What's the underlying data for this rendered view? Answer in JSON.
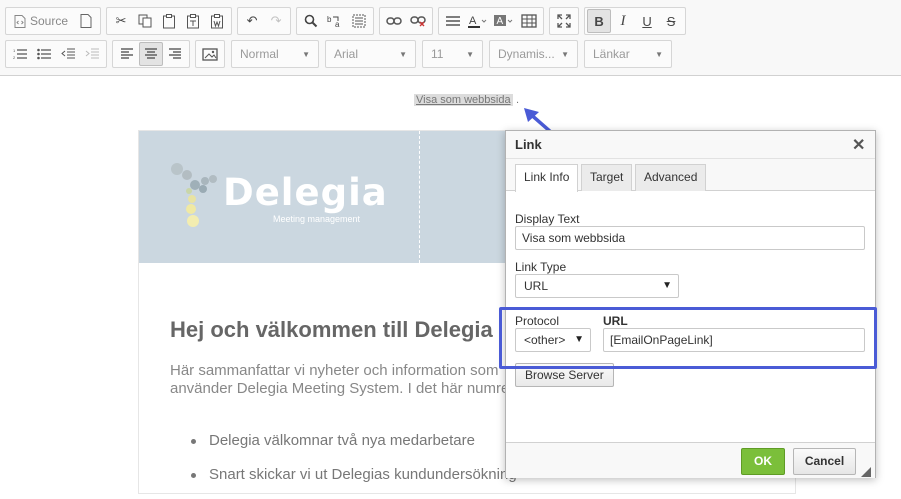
{
  "toolbar": {
    "source_label": "Source",
    "format_combo": "Normal",
    "font_combo": "Arial",
    "size_combo": "11",
    "dynamic_combo": "Dynamis...",
    "links_combo": "Länkar"
  },
  "editor": {
    "web_link_text": "Visa som webbsida",
    "web_link_dot": "."
  },
  "email": {
    "logo_text": "Delegia",
    "logo_subtitle": "Meeting management",
    "heading": "Hej och välkommen till Delegia",
    "paragraph_lines": [
      "Här sammanfattar vi nyheter och information som",
      "använder Delegia Meeting System. I det här numret"
    ],
    "list_items": [
      "Delegia välkomnar två nya medarbetare",
      "Snart skickar vi ut Delegias kundundersökning"
    ]
  },
  "dialog": {
    "title": "Link",
    "tabs": [
      "Link Info",
      "Target",
      "Advanced"
    ],
    "display_text_label": "Display Text",
    "display_text_value": "Visa som webbsida",
    "link_type_label": "Link Type",
    "link_type_value": "URL",
    "protocol_label": "Protocol",
    "protocol_value": "<other>",
    "url_label": "URL",
    "url_value": "[EmailOnPageLink]",
    "browse_label": "Browse Server",
    "ok_label": "OK",
    "cancel_label": "Cancel"
  },
  "colors": {
    "accent_highlight": "#4a5bd6",
    "ok_button": "#7bbf3a",
    "banner": "#cbd7e0"
  }
}
